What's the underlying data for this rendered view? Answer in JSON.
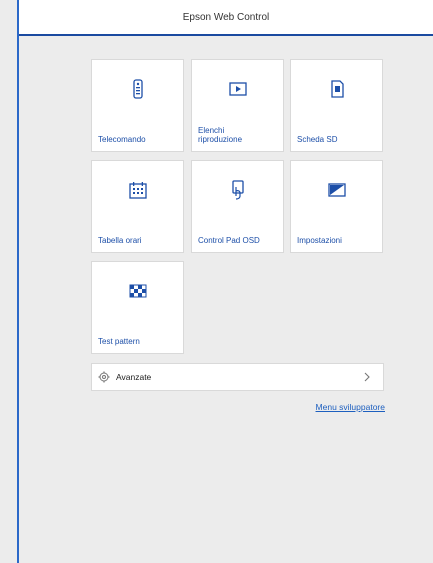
{
  "header": {
    "title": "Epson Web Control"
  },
  "tiles": [
    {
      "label": "Telecomando",
      "icon": "remote-control-icon"
    },
    {
      "label": "Elenchi riproduzione",
      "icon": "play-icon"
    },
    {
      "label": "Scheda SD",
      "icon": "sd-card-icon"
    },
    {
      "label": "Tabella orari",
      "icon": "calendar-icon"
    },
    {
      "label": "Control Pad OSD",
      "icon": "touch-pad-icon"
    },
    {
      "label": "Impostazioni",
      "icon": "screen-settings-icon"
    },
    {
      "label": "Test pattern",
      "icon": "checkerboard-icon"
    }
  ],
  "advanced": {
    "label": "Avanzate",
    "icon": "gear-icon"
  },
  "developer_link": "Menu sviluppatore",
  "colors": {
    "accent": "#1d4fa8",
    "header_rule": "#1a4aa0",
    "background": "#ececec"
  }
}
